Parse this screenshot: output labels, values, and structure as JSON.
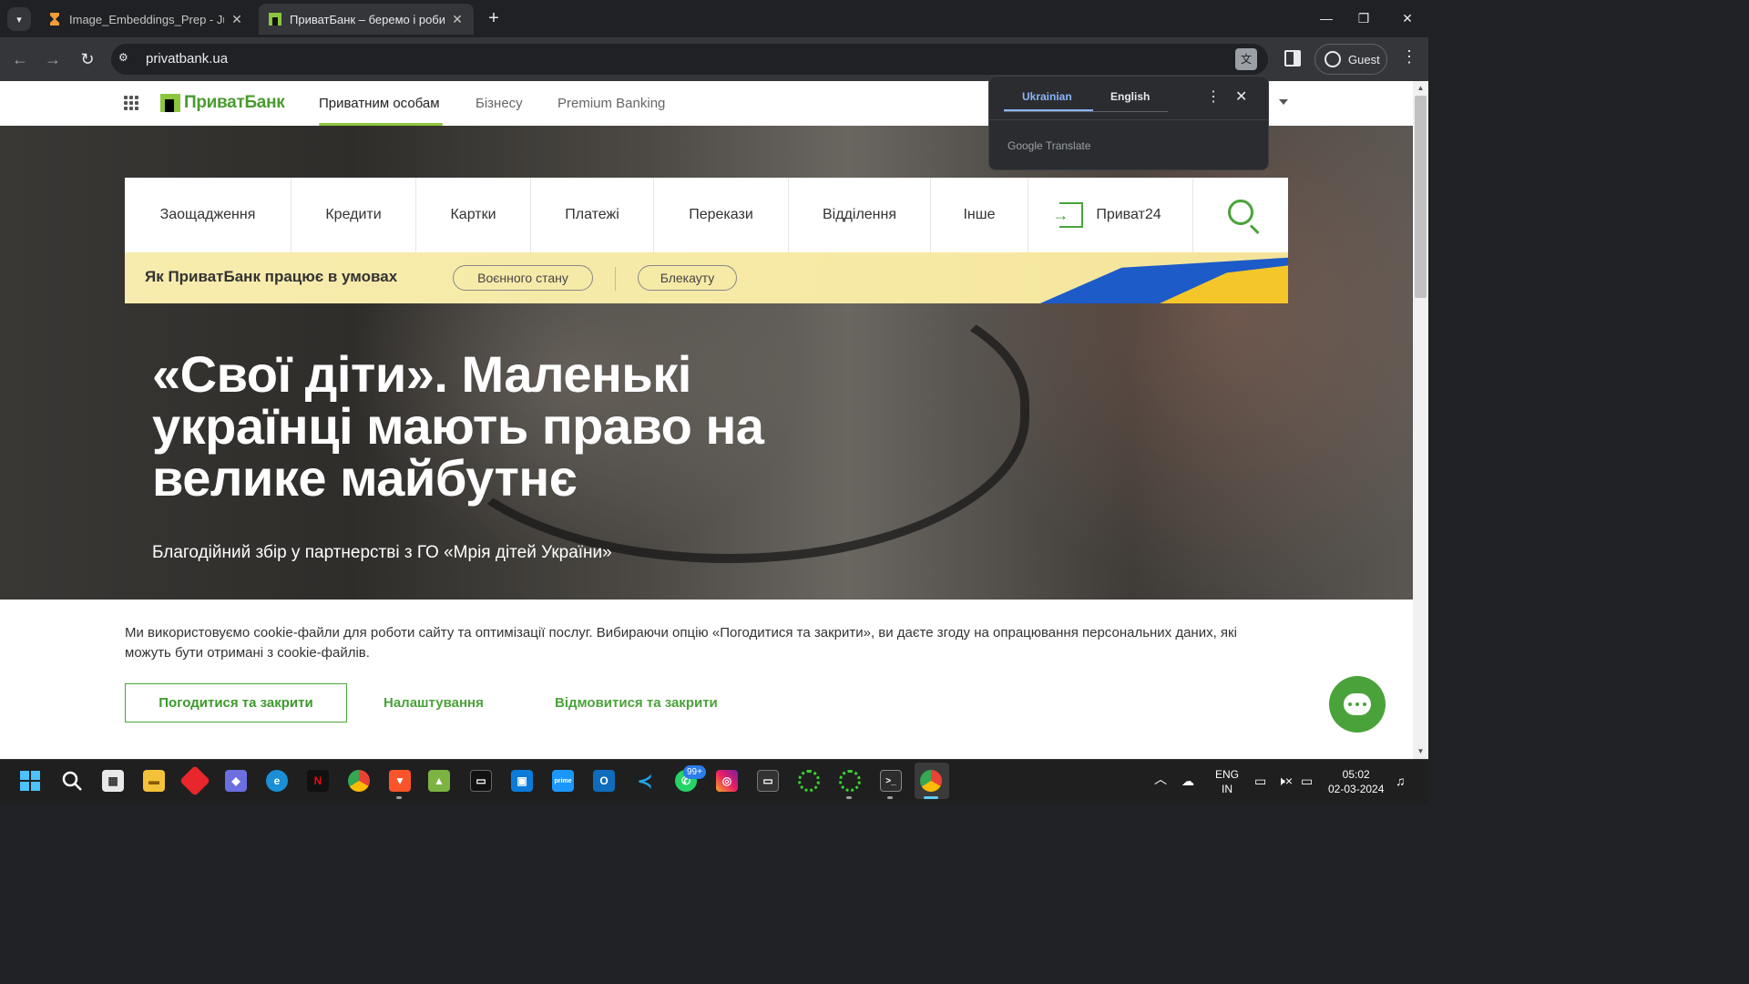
{
  "browser": {
    "tabs": [
      {
        "title": "Image_Embeddings_Prep - Jupy",
        "active": false,
        "favicon": "hourglass-icon"
      },
      {
        "title": "ПриватБанк – беремо і робимо",
        "active": true,
        "favicon": "privatbank-favicon"
      }
    ],
    "url": "privatbank.ua",
    "profile_label": "Guest"
  },
  "translate_popup": {
    "tab_source": "Ukrainian",
    "tab_target": "English",
    "brand": "Google Translate"
  },
  "header": {
    "logo_text": "ПриватБанк",
    "nav": [
      "Приватним особам",
      "Бізнесу",
      "Premium Banking"
    ]
  },
  "main_nav": {
    "items": [
      "Заощадження",
      "Кредити",
      "Картки",
      "Платежі",
      "Перекази",
      "Відділення",
      "Інше"
    ],
    "privat24_label": "Приват24"
  },
  "banner": {
    "text": "Як ПриватБанк працює в умовах",
    "pill_1": "Воєнного стану",
    "pill_2": "Блекауту"
  },
  "hero": {
    "headline": "«Свої діти». Маленькі українці мають право на велике майбутнє",
    "subline": "Благодійний збір у партнерстві з ГО «Мрія дітей України»"
  },
  "cookie": {
    "text": "Ми використовуємо cookie-файли для роботи сайту та оптимізації послуг. Вибираючи опцію «Погодитися та закрити», ви даєте згоду на опрацювання персональних даних, які можуть бути отримані з cookie-файлів.",
    "agree_label": "Погодитися та закрити",
    "settings_label": "Налаштування",
    "decline_label": "Відмовитися та закрити"
  },
  "taskbar": {
    "whatsapp_badge": "99+",
    "language": "ENG",
    "region": "IN",
    "time": "05:02",
    "date": "02-03-2024"
  },
  "colors": {
    "brand_green": "#4aa33a",
    "logo_green": "#8cc63f",
    "banner_yellow": "#f7ecad",
    "chrome_dark": "#202124"
  }
}
